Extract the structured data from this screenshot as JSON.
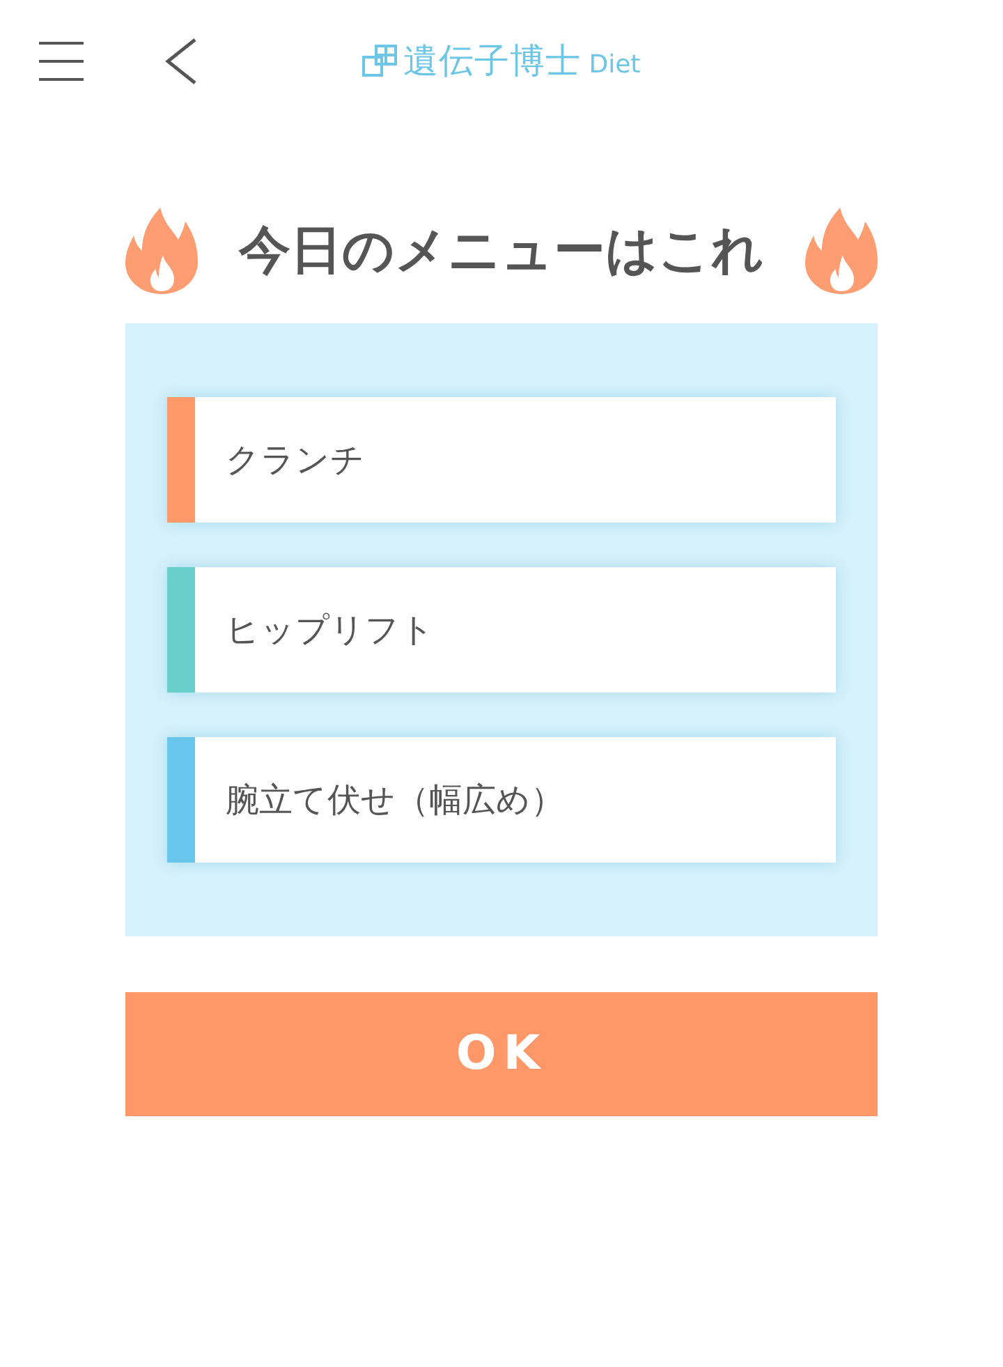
{
  "header": {
    "logo_text": "遺伝子博士",
    "logo_suffix": "Diet"
  },
  "title": "今日のメニューはこれ",
  "menu_items": [
    {
      "label": "クランチ",
      "color": "#ff9869"
    },
    {
      "label": "ヒップリフト",
      "color": "#6acfcb"
    },
    {
      "label": "腕立て伏せ（幅広め）",
      "color": "#68c6ed"
    }
  ],
  "ok_button": "OK"
}
